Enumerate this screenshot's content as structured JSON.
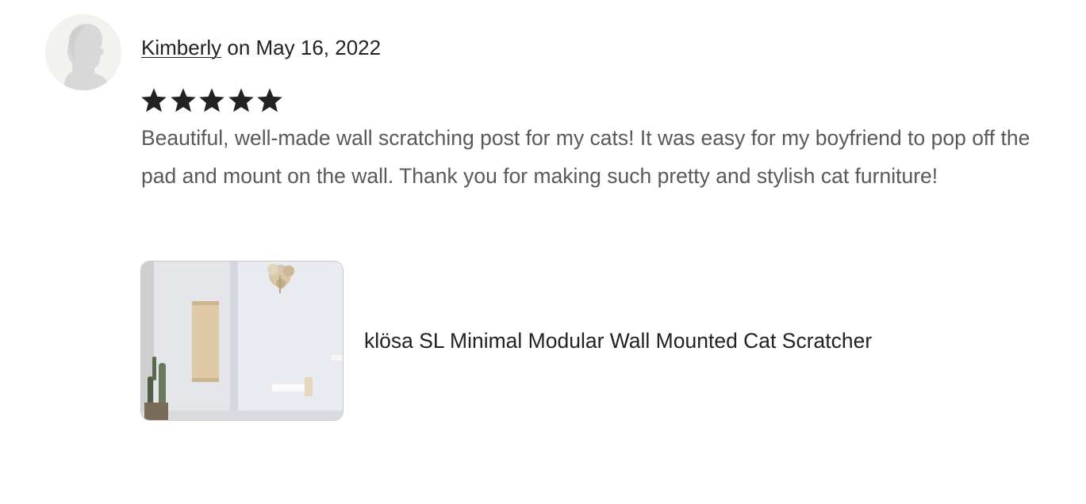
{
  "review": {
    "reviewer_name": "Kimberly",
    "date_text": "on May 16, 2022",
    "rating": 5,
    "rating_max": 5,
    "body": "Beautiful, well-made wall scratching post for my cats! It was easy for my boyfriend to pop off the pad and mount on the wall. Thank you for making such pretty and stylish cat furniture!"
  },
  "product": {
    "title": "klösa SL Minimal Modular Wall Mounted Cat Scratcher"
  },
  "icons": {
    "avatar": "default-user-silhouette-icon",
    "star": "star-filled-icon"
  },
  "colors": {
    "text_primary": "#222222",
    "text_secondary": "#595959",
    "star": "#222222",
    "avatar_bg": "#f2f2ef",
    "avatar_silhouette": "#d6d6d6"
  }
}
